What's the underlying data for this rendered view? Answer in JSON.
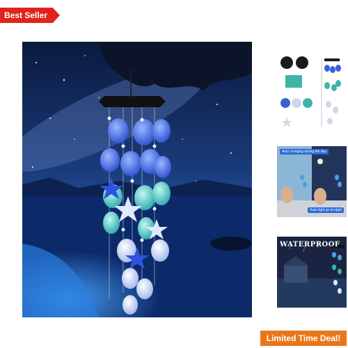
{
  "badges": {
    "best_seller": "Best Seller",
    "limited_deal": "Limited Time Deal!"
  },
  "thumbnails": {
    "thumb2_caption_top": "Auto charging during the day",
    "thumb2_caption_bottom": "Auto light up at night",
    "thumb3_title": "WATERPROOF"
  },
  "colors": {
    "best_seller_bg": "#e0241b",
    "deal_bg": "#e8771a"
  }
}
